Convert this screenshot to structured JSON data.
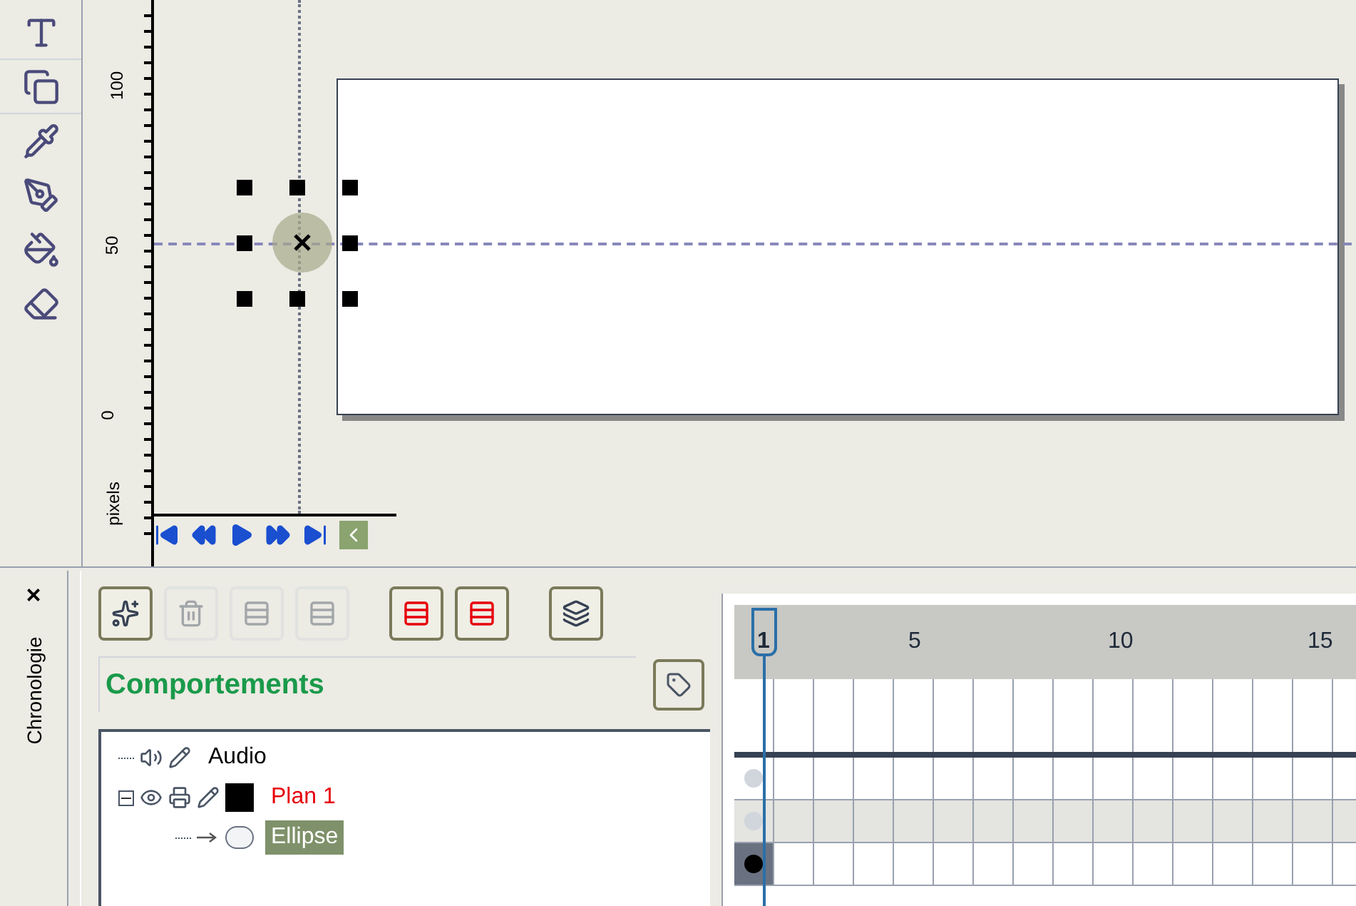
{
  "toolbox": {
    "tools": [
      {
        "kind": "text"
      },
      {
        "kind": "clone"
      },
      {
        "kind": "dropper"
      },
      {
        "kind": "pen"
      },
      {
        "kind": "fill"
      },
      {
        "kind": "eraser"
      }
    ]
  },
  "ruler": {
    "labels": [
      "100",
      "50",
      "0"
    ],
    "unit": "pixels"
  },
  "playback": {
    "buttons": [
      {
        "kind": "first"
      },
      {
        "kind": "rewind"
      },
      {
        "kind": "play"
      },
      {
        "kind": "forward"
      },
      {
        "kind": "last"
      },
      {
        "kind": "collapse"
      }
    ]
  },
  "panel": {
    "title": "Chronologie",
    "close": "×"
  },
  "layer_toolbar": {
    "buttons": [
      {
        "kind": "new",
        "disabled": false
      },
      {
        "kind": "delete",
        "disabled": true
      },
      {
        "kind": "insert",
        "disabled": true
      },
      {
        "kind": "remove",
        "disabled": true
      },
      {
        "kind": "add-frame",
        "disabled": false
      },
      {
        "kind": "delete-frame",
        "disabled": false
      },
      {
        "kind": "layers",
        "disabled": false
      }
    ]
  },
  "behaviors": {
    "label": "Comportements"
  },
  "tree": [
    {
      "label": "Audio",
      "kind": "audio",
      "active": false,
      "selected": false
    },
    {
      "label": "Plan 1",
      "kind": "layer",
      "active": true,
      "selected": false,
      "expanded": true,
      "children": [
        {
          "label": "Ellipse",
          "kind": "shape",
          "active": false,
          "selected": true
        }
      ]
    }
  ],
  "timeline": {
    "frame_labels": [
      "1",
      "5",
      "10",
      "15"
    ]
  }
}
